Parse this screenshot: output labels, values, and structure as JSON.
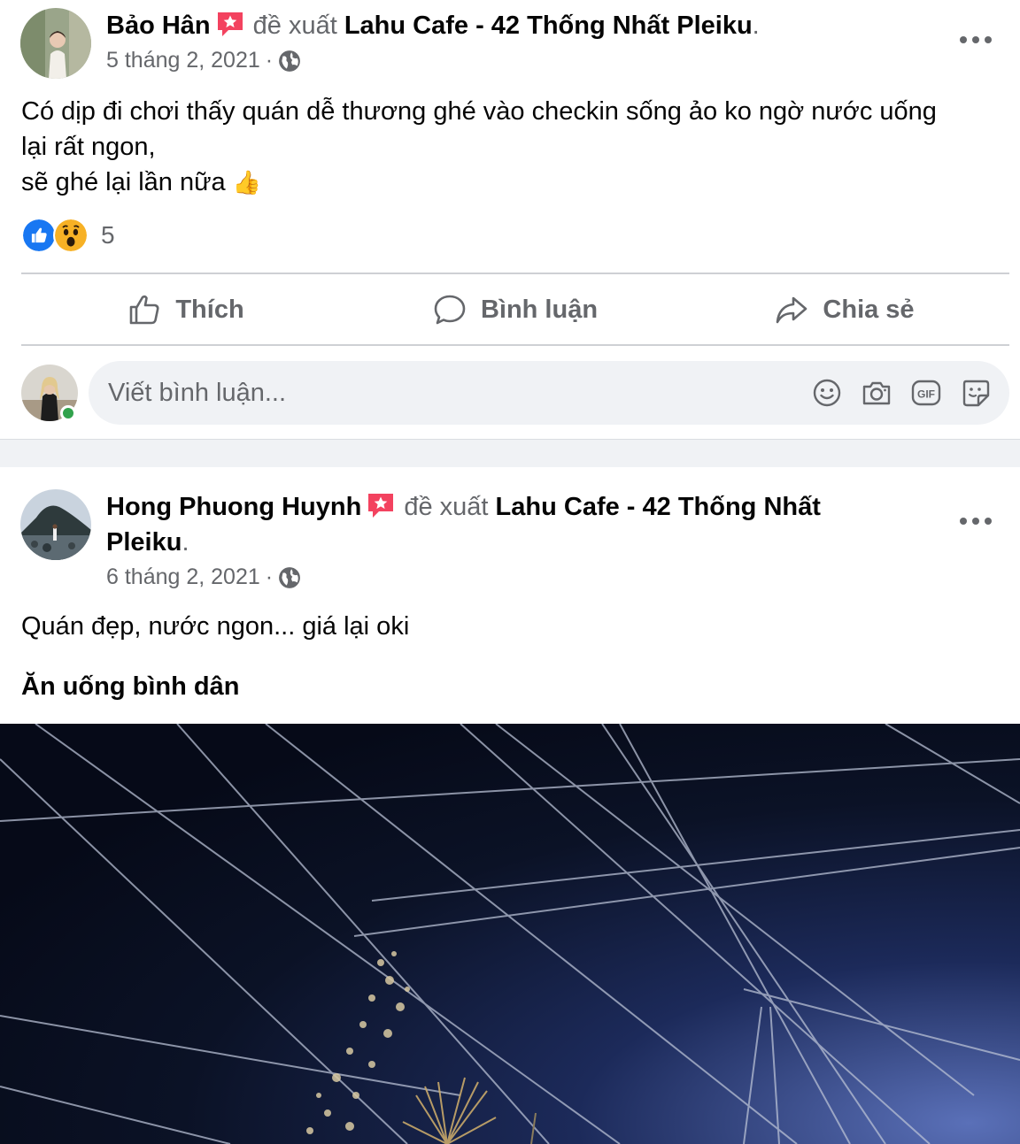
{
  "posts": [
    {
      "author": "Bảo Hân",
      "action": "đề xuất",
      "page": "Lahu Cafe - 42 Thống Nhất Pleiku",
      "period": ".",
      "date": "5 tháng 2, 2021",
      "dot": "·",
      "text_lines": [
        "Có dịp đi chơi thấy quán dễ thương ghé vào checkin sống ảo ko ngờ nước uống",
        "lại rất ngon,",
        "sẽ ghé lại lần nữa"
      ],
      "emoji": "👍",
      "reaction_count": "5"
    },
    {
      "author": "Hong Phuong Huynh",
      "action": "đề xuất",
      "page_line1": "Lahu Cafe - 42 Thống Nhất",
      "page_line2": "Pleiku",
      "period": ".",
      "date": "6 tháng 2, 2021",
      "dot": "·",
      "text": "Quán đẹp, nước ngon... giá lại oki",
      "tag": "Ăn uống bình dân"
    }
  ],
  "actions": {
    "like": "Thích",
    "comment": "Bình luận",
    "share": "Chia sẻ"
  },
  "comment_box": {
    "placeholder": "Viết bình luận..."
  },
  "icons": {
    "more": "more-dots-icon",
    "audience": "globe-icon",
    "recommend": "recommend-star-icon",
    "like_reaction": "like-reaction-icon",
    "wow_reaction": "wow-reaction-icon",
    "emoji_tool": "emoji-icon",
    "camera_tool": "camera-icon",
    "gif_tool": "gif-icon",
    "sticker_tool": "sticker-icon"
  },
  "colors": {
    "recommend_badge": "#f3425f",
    "like_blue": "#1877f2",
    "wow_yellow": "#f7b125",
    "online_green": "#31a24c",
    "secondary_text": "#65676b"
  }
}
